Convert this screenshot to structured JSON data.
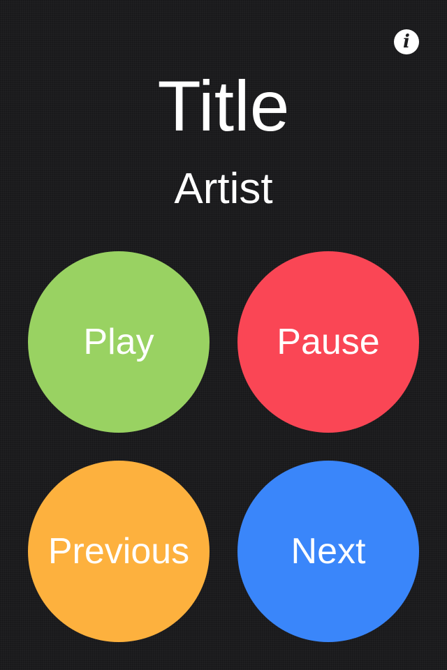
{
  "header": {
    "info_icon_glyph": "i",
    "title": "Title",
    "artist": "Artist"
  },
  "controls": {
    "play": {
      "label": "Play",
      "color": "#99d262"
    },
    "pause": {
      "label": "Pause",
      "color": "#fa4655"
    },
    "previous": {
      "label": "Previous",
      "color": "#fdb13e"
    },
    "next": {
      "label": "Next",
      "color": "#3a86fa"
    }
  },
  "icons": {
    "info": "info-icon"
  },
  "colors": {
    "background": "#1c1c1e",
    "text": "#ffffff"
  }
}
